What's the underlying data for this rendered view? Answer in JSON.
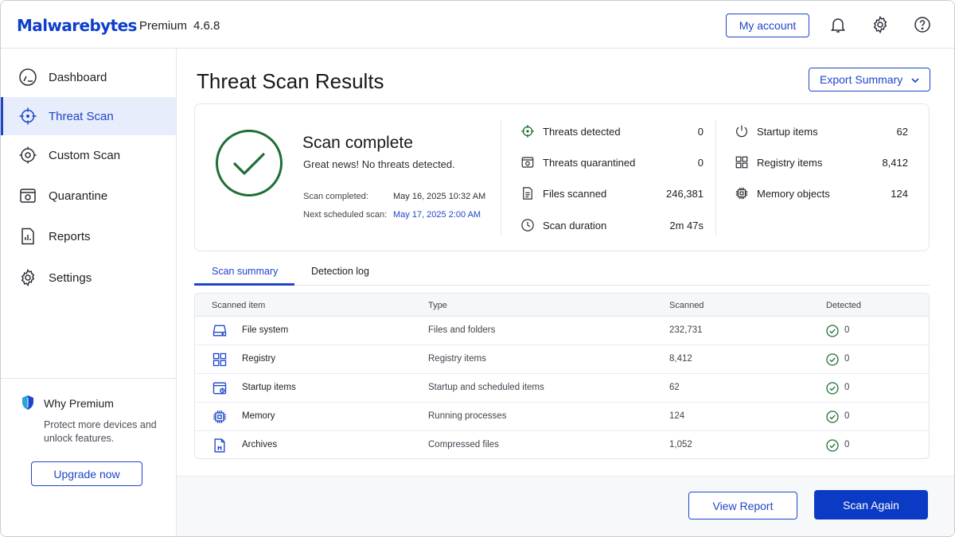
{
  "app": {
    "brand": "Malwarebytes",
    "edition": "Premium",
    "version": "4.6.8"
  },
  "header": {
    "my_account": "My account",
    "icons": [
      "bell-icon",
      "gear-icon",
      "help-icon"
    ]
  },
  "sidebar": {
    "items": [
      {
        "label": "Dashboard",
        "icon": "dashboard-icon",
        "active": false
      },
      {
        "label": "Threat Scan",
        "icon": "crosshair-icon",
        "active": true
      },
      {
        "label": "Custom Scan",
        "icon": "target-icon",
        "active": false
      },
      {
        "label": "Quarantine",
        "icon": "quarantine-icon",
        "active": false
      },
      {
        "label": "Reports",
        "icon": "report-icon",
        "active": false
      },
      {
        "label": "Settings",
        "icon": "gear-icon",
        "active": false
      }
    ],
    "premium": {
      "title": "Why Premium",
      "description": "Protect more devices and unlock features.",
      "button": "Upgrade now"
    }
  },
  "main": {
    "title": "Threat Scan Results",
    "export_button": "Export Summary",
    "summary": {
      "status": "Scan complete",
      "message": "Great news! No threats detected.",
      "completed_label": "Scan completed:",
      "completed_value": "May 16, 2025 10:32 AM",
      "next_label": "Next scheduled scan:",
      "next_value": "May 17, 2025 2:00 AM",
      "stats_left": [
        {
          "label": "Threats detected",
          "value": "0",
          "icon": "crosshair-icon"
        },
        {
          "label": "Threats quarantined",
          "value": "0",
          "icon": "quarantine-icon"
        },
        {
          "label": "Files scanned",
          "value": "246,381",
          "icon": "file-icon"
        },
        {
          "label": "Scan duration",
          "value": "2m 47s",
          "icon": "clock-icon"
        }
      ],
      "stats_right": [
        {
          "label": "Startup items",
          "value": "62",
          "icon": "power-icon"
        },
        {
          "label": "Registry items",
          "value": "8,412",
          "icon": "grid-icon"
        },
        {
          "label": "Memory objects",
          "value": "124",
          "icon": "chip-icon"
        }
      ]
    },
    "tabs": [
      {
        "label": "Scan summary",
        "active": true
      },
      {
        "label": "Detection log",
        "active": false
      }
    ],
    "table": {
      "headers": [
        "Scanned item",
        "Type",
        "Scanned",
        "Detected"
      ],
      "rows": [
        {
          "item": "File system",
          "type": "Files and folders",
          "scanned": "232,731",
          "detected": "0",
          "icon": "drive-icon"
        },
        {
          "item": "Registry",
          "type": "Registry items",
          "scanned": "8,412",
          "detected": "0",
          "icon": "grid-icon"
        },
        {
          "item": "Startup items",
          "type": "Startup and scheduled items",
          "scanned": "62",
          "detected": "0",
          "icon": "startup-icon"
        },
        {
          "item": "Memory",
          "type": "Running processes",
          "scanned": "124",
          "detected": "0",
          "icon": "chip-icon"
        },
        {
          "item": "Archives",
          "type": "Compressed files",
          "scanned": "1,052",
          "detected": "0",
          "icon": "archive-icon"
        }
      ]
    }
  },
  "footer": {
    "view_report": "View Report",
    "scan_again": "Scan Again"
  },
  "colors": {
    "accent": "#1f45c8",
    "primary_button": "#0b3bc4",
    "success": "#1f7a3a",
    "active_nav_bg": "#e7edfb"
  }
}
